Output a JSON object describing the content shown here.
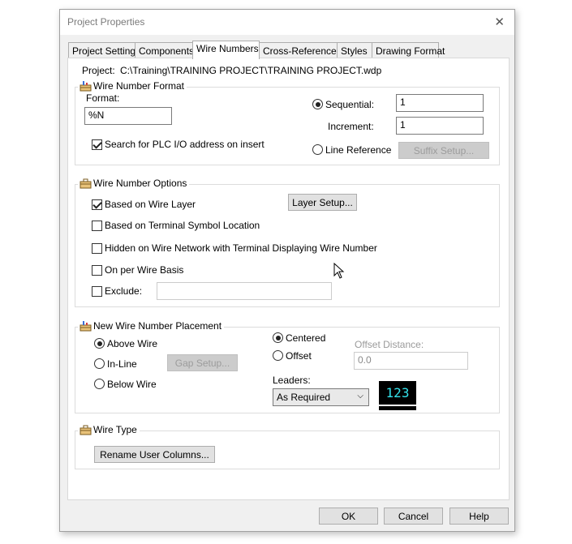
{
  "window": {
    "title": "Project Properties",
    "close_glyph": "✕"
  },
  "tabs": [
    {
      "label": "Project Settings",
      "active": false
    },
    {
      "label": "Components",
      "active": false
    },
    {
      "label": "Wire Numbers",
      "active": true
    },
    {
      "label": "Cross-References",
      "active": false
    },
    {
      "label": "Styles",
      "active": false
    },
    {
      "label": "Drawing Format",
      "active": false
    }
  ],
  "project": {
    "label": "Project:",
    "path": "C:\\Training\\TRAINING PROJECT\\TRAINING PROJECT.wdp"
  },
  "wire_number_format": {
    "title": "Wire Number Format",
    "format_label": "Format:",
    "format_value": "%N",
    "search_plc_label": "Search for PLC I/O address on insert",
    "search_plc_checked": true,
    "sequential_label": "Sequential:",
    "sequential_selected": true,
    "sequential_value": "1",
    "increment_label": "Increment:",
    "increment_value": "1",
    "line_reference_label": "Line Reference",
    "line_reference_selected": false,
    "suffix_setup_label": "Suffix Setup..."
  },
  "wire_number_options": {
    "title": "Wire Number Options",
    "based_on_layer_label": "Based on Wire Layer",
    "based_on_layer_checked": true,
    "layer_setup_label": "Layer Setup...",
    "terminal_location_label": "Based on Terminal Symbol Location",
    "hidden_label": "Hidden on Wire Network with Terminal Displaying Wire Number",
    "per_wire_label": "On per Wire Basis",
    "exclude_label": "Exclude:",
    "exclude_value": ""
  },
  "placement": {
    "title": "New Wire Number Placement",
    "above_label": "Above Wire",
    "inline_label": "In-Line",
    "below_label": "Below Wire",
    "gap_setup_label": "Gap Setup...",
    "centered_label": "Centered",
    "offset_label": "Offset",
    "offset_distance_label": "Offset Distance:",
    "offset_distance_value": "0.0",
    "leaders_label": "Leaders:",
    "leaders_value": "As Required",
    "preview_text": "123"
  },
  "wire_type": {
    "title": "Wire Type",
    "rename_label": "Rename User Columns..."
  },
  "footer": {
    "ok": "OK",
    "cancel": "Cancel",
    "help": "Help"
  },
  "colors": {
    "preview_bg": "#000000",
    "preview_text": "#34e3ec"
  }
}
